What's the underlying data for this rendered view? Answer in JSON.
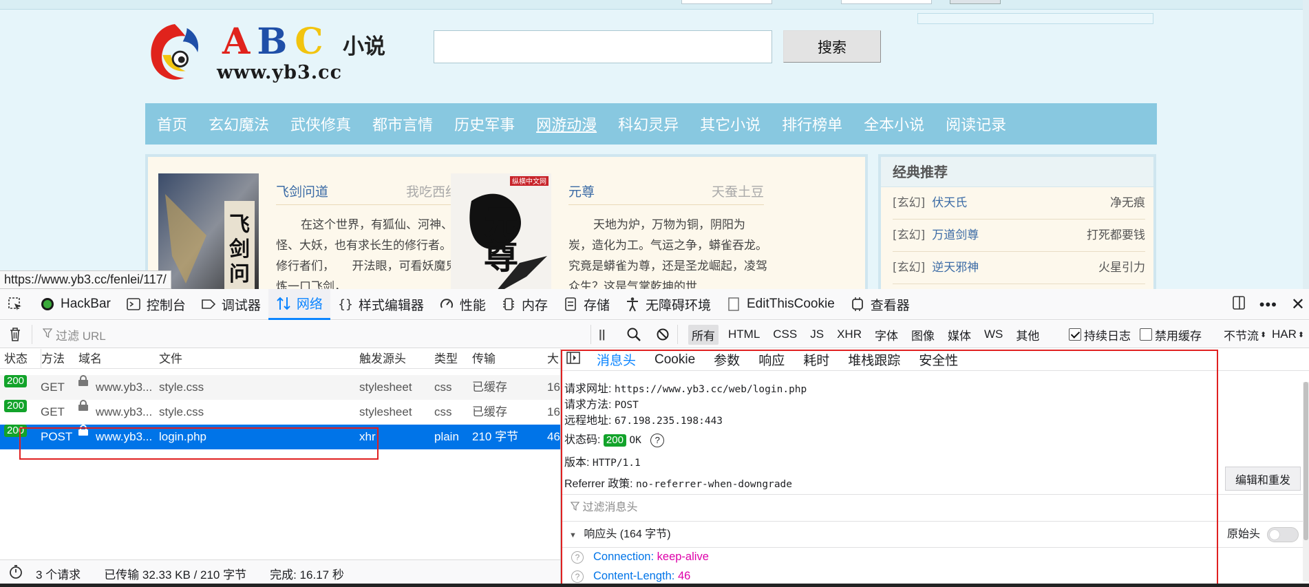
{
  "site": {
    "status_url": "https://www.yb3.cc/fenlei/117/",
    "logo": {
      "abc": "A B C",
      "cn": "小说",
      "url": "www.yb3.cc"
    },
    "search_button": "搜索",
    "nav": [
      "首页",
      "玄幻魔法",
      "武侠修真",
      "都市言情",
      "历史军事",
      "网游动漫",
      "科幻灵异",
      "其它小说",
      "排行榜单",
      "全本小说",
      "阅读记录"
    ],
    "nav_current": "网游动漫",
    "books": [
      {
        "title": "飞剑问道",
        "author": "我吃西红柿",
        "desc": "在这个世界，有狐仙、河神、水怪、大妖，也有求长生的修行者。　　修行者们，　　开法眼，可看妖魔鬼怪。　　炼一口飞剑，",
        "cover_text": "飞剑问道"
      },
      {
        "title": "元尊",
        "author": "天蚕土豆",
        "desc": "天地为炉，万物为铜，阴阳为炭，造化为工。气运之争，蟒雀吞龙。究竟是蟒雀为尊，还是圣龙崛起，凌驾众生？这是气掌乾坤的世",
        "cover_text": "元尊",
        "cover_badge": "纵横中文网"
      }
    ],
    "recommend": {
      "title": "经典推荐",
      "items": [
        {
          "cat": "[玄幻]",
          "book": "伏天氏",
          "author": "净无痕"
        },
        {
          "cat": "[玄幻]",
          "book": "万道剑尊",
          "author": "打死都要钱"
        },
        {
          "cat": "[玄幻]",
          "book": "逆天邪神",
          "author": "火星引力"
        }
      ]
    }
  },
  "devtools": {
    "tabs": [
      {
        "label": "HackBar",
        "icon": "hackbar-icon"
      },
      {
        "label": "控制台",
        "icon": "console-icon"
      },
      {
        "label": "调试器",
        "icon": "debugger-icon"
      },
      {
        "label": "网络",
        "icon": "network-icon",
        "active": true
      },
      {
        "label": "样式编辑器",
        "icon": "style-editor-icon"
      },
      {
        "label": "性能",
        "icon": "performance-icon"
      },
      {
        "label": "内存",
        "icon": "memory-icon"
      },
      {
        "label": "存储",
        "icon": "storage-icon"
      },
      {
        "label": "无障碍环境",
        "icon": "accessibility-icon"
      },
      {
        "label": "EditThisCookie",
        "icon": "cookie-icon"
      },
      {
        "label": "查看器",
        "icon": "inspector-icon"
      }
    ],
    "toolbar": {
      "filter_placeholder": "过滤 URL",
      "pause": "||",
      "types": [
        "所有",
        "HTML",
        "CSS",
        "JS",
        "XHR",
        "字体",
        "图像",
        "媒体",
        "WS",
        "其他"
      ],
      "active_type": "所有",
      "persist_log": "持续日志",
      "disable_cache": "禁用缓存",
      "throttle": "不节流",
      "har": "HAR"
    },
    "columns": [
      "状态",
      "方法",
      "域名",
      "文件",
      "触发源头",
      "类型",
      "传输",
      "大"
    ],
    "requests": [
      {
        "status": "200",
        "method": "GET",
        "domain": "www.yb3...",
        "file": "style.css",
        "cause": "stylesheet",
        "type": "css",
        "transfer": "已缓存",
        "size": "16"
      },
      {
        "status": "200",
        "method": "GET",
        "domain": "www.yb3...",
        "file": "style.css",
        "cause": "stylesheet",
        "type": "css",
        "transfer": "已缓存",
        "size": "16"
      },
      {
        "status": "200",
        "method": "POST",
        "domain": "www.yb3...",
        "file": "login.php",
        "cause": "xhr",
        "type": "plain",
        "transfer": "210 字节",
        "size": "46",
        "selected": true
      }
    ],
    "summary": {
      "requests": "3 个请求",
      "transferred": "已传输 32.33 KB / 210 字节",
      "finish": "完成: 16.17 秒"
    },
    "detail_tabs": [
      "消息头",
      "Cookie",
      "参数",
      "响应",
      "耗时",
      "堆栈跟踪",
      "安全性"
    ],
    "headers": {
      "url_label": "请求网址:",
      "url": "https://www.yb3.cc/web/login.php",
      "method_label": "请求方法:",
      "method": "POST",
      "remote_label": "远程地址:",
      "remote": "67.198.235.198:443",
      "status_label": "状态码:",
      "status": "200",
      "status_text": "OK",
      "version_label": "版本:",
      "version": "HTTP/1.1",
      "referrer_label": "Referrer 政策:",
      "referrer": "no-referrer-when-downgrade",
      "resend": "编辑和重发",
      "filter_placeholder": "过滤消息头",
      "response_head": "响应头 (164 字节)",
      "raw": "原始头",
      "rows": [
        {
          "name": "Connection:",
          "value": "keep-alive"
        },
        {
          "name": "Content-Length:",
          "value": "46"
        }
      ]
    },
    "colors": {
      "accent": "#0a84ff",
      "selected_row": "#0074e8",
      "status_ok": "#12a32a",
      "highlight": "#e02020"
    }
  }
}
